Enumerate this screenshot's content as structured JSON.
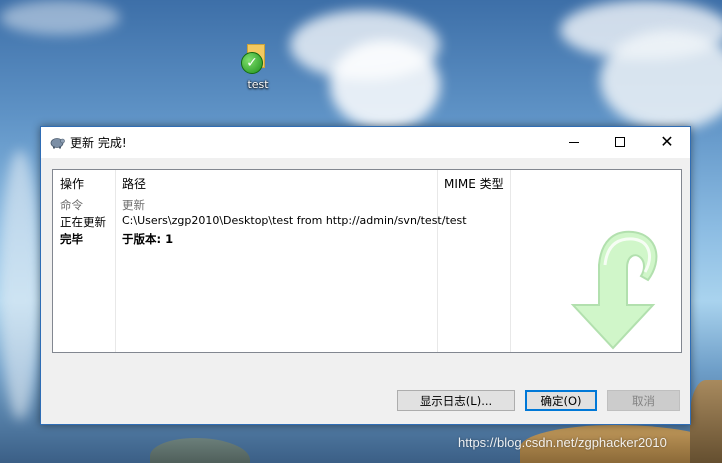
{
  "desktop": {
    "icon_label": "test"
  },
  "dialog": {
    "title": "更新 完成!",
    "columns": {
      "action": "操作",
      "path": "路径",
      "mime": "MIME 类型"
    },
    "rows": [
      {
        "action": "命令",
        "path": "更新",
        "style": "muted"
      },
      {
        "action": "正在更新",
        "path": "C:\\Users\\zgp2010\\Desktop\\test from http://admin/svn/test/test",
        "style": "normal"
      },
      {
        "action": "完毕",
        "path": "于版本: 1",
        "style": "bold"
      }
    ],
    "buttons": {
      "show_log": "显示日志(L)...",
      "ok": "确定(O)",
      "cancel": "取消"
    }
  },
  "watermark_text": "https://blog.csdn.net/zgphacker2010",
  "colors": {
    "window_border": "#2f6db5",
    "ok_button_focus": "#0078d7",
    "arrow_fill": "#c8f5c0"
  },
  "icons": [
    "tortoisesvn-icon",
    "green-check-overlay-icon",
    "update-arrow-watermark-icon"
  ]
}
